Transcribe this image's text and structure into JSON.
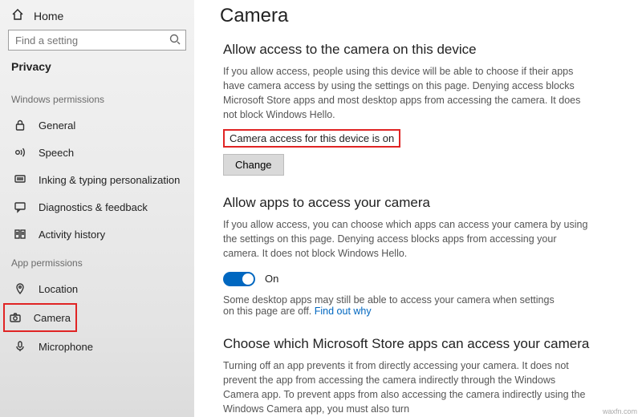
{
  "sidebar": {
    "home_label": "Home",
    "search_placeholder": "Find a setting",
    "category_label": "Privacy",
    "windows_permissions_label": "Windows permissions",
    "app_permissions_label": "App permissions",
    "items": {
      "general": "General",
      "speech": "Speech",
      "inking": "Inking & typing personalization",
      "diagnostics": "Diagnostics & feedback",
      "activity": "Activity history",
      "location": "Location",
      "camera": "Camera",
      "microphone": "Microphone"
    }
  },
  "main": {
    "title": "Camera",
    "sec1": {
      "title": "Allow access to the camera on this device",
      "desc": "If you allow access, people using this device will be able to choose if their apps have camera access by using the settings on this page. Denying access blocks Microsoft Store apps and most desktop apps from accessing the camera. It does not block Windows Hello.",
      "status": "Camera access for this device is on",
      "change": "Change"
    },
    "sec2": {
      "title": "Allow apps to access your camera",
      "desc": "If you allow access, you can choose which apps can access your camera by using the settings on this page. Denying access blocks apps from accessing your camera. It does not block Windows Hello.",
      "toggle_state": "On",
      "note_prefix": "Some desktop apps may still be able to access your camera when settings on this page are off. ",
      "note_link": "Find out why"
    },
    "sec3": {
      "title": "Choose which Microsoft Store apps can access your camera",
      "desc": "Turning off an app prevents it from directly accessing your camera. It does not prevent the app from accessing the camera indirectly through the Windows Camera app. To prevent apps from also accessing the camera indirectly using the Windows Camera app, you must also turn"
    }
  },
  "watermark": "waxfn.com"
}
